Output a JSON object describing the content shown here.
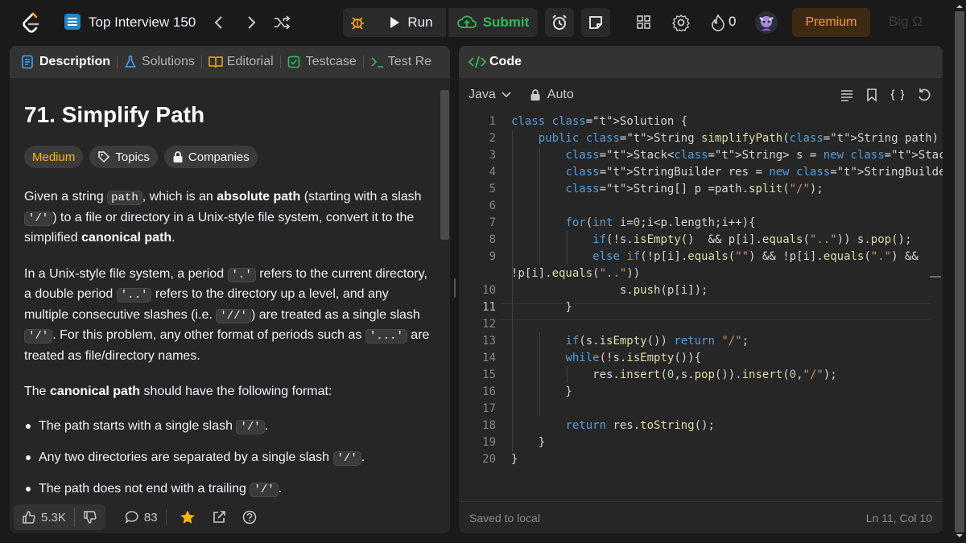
{
  "header": {
    "title": "Top Interview 150",
    "run_label": "Run",
    "submit_label": "Submit",
    "streak_count": "0",
    "premium_label": "Premium",
    "bigo_label": "Big Ω",
    "icons": [
      "leetcode-logo-icon",
      "list-icon",
      "chevron-left-icon",
      "chevron-right-icon",
      "shuffle-icon",
      "debug-icon",
      "run-play-icon",
      "upload-cloud-icon",
      "alarm-icon",
      "note-icon",
      "layout-icon",
      "gear-icon",
      "flame-icon",
      "avatar-icon"
    ]
  },
  "left_panel": {
    "tabs": [
      {
        "label": "Description",
        "icon": "document-icon",
        "active": true
      },
      {
        "label": "Solutions",
        "icon": "flask-icon"
      },
      {
        "label": "Editorial",
        "icon": "book-icon"
      },
      {
        "label": "Testcase",
        "icon": "check-box-icon"
      },
      {
        "label": "Test Re",
        "icon": "terminal-icon"
      }
    ],
    "problem_title": "71. Simplify Path",
    "difficulty": "Medium",
    "topics_label": "Topics",
    "companies_label": "Companies",
    "paragraphs": {
      "p1": {
        "a": "Given a string ",
        "code1": "path",
        "b": ", which is an ",
        "bold1": "absolute path",
        "c": " (starting with a slash ",
        "code2": "'/'",
        "d": ") to a file or directory in a Unix-style file system, convert it to the simplified ",
        "bold2": "canonical path",
        "e": "."
      },
      "p2": {
        "a": "In a Unix-style file system, a period ",
        "code1": "'.'",
        "b": " refers to the current directory, a double period ",
        "code2": "'..'",
        "c": " refers to the directory up a level, and any multiple consecutive slashes (i.e. ",
        "code3": "'//'",
        "d": ") are treated as a single slash ",
        "code4": "'/'",
        "e": ". For this problem, any other format of periods such as ",
        "code5": "'...'",
        "f": " are treated as file/directory names."
      },
      "p3": {
        "a": "The ",
        "bold": "canonical path",
        "b": " should have the following format:"
      }
    },
    "bullets": [
      {
        "text": "The path starts with a single slash ",
        "code": "'/'",
        "end": "."
      },
      {
        "text": "Any two directories are separated by a single slash ",
        "code": "'/'",
        "end": "."
      },
      {
        "text": "The path does not end with a trailing ",
        "code": "'/'",
        "end": "."
      }
    ],
    "footer": {
      "likes": "5.3K",
      "comments": "83"
    }
  },
  "right_panel": {
    "tab_label": "Code",
    "language": "Java",
    "mode": "Auto",
    "status": "Saved to local",
    "cursor": "Ln 11, Col 10",
    "current_line": 11,
    "code_lines": [
      "class Solution {",
      "    public String simplifyPath(String path) {",
      "        Stack<String> s = new Stack<>();",
      "        StringBuilder res = new StringBuilder();",
      "        String[] p =path.split(\"/\");",
      "",
      "        for(int i=0;i<p.length;i++){",
      "            if(!s.isEmpty()  && p[i].equals(\"..\")) s.pop();",
      "            else if(!p[i].equals(\"\") && !p[i].equals(\".\") &&",
      "!p[i].equals(\"..\"))",
      "                s.push(p[i]);",
      "        }",
      "",
      "        if(s.isEmpty()) return \"/\";",
      "        while(!s.isEmpty()){",
      "            res.insert(0,s.pop()).insert(0,\"/\");",
      "        }",
      "",
      "        return res.toString();",
      "    }",
      "}"
    ],
    "line_numbers": [
      "1",
      "2",
      "3",
      "4",
      "5",
      "6",
      "7",
      "8",
      "9",
      "",
      "10",
      "11",
      "12",
      "13",
      "14",
      "15",
      "16",
      "17",
      "18",
      "19",
      "20"
    ]
  },
  "colors": {
    "accent": "#ffa116",
    "success": "#2cbb5d",
    "medium": "#ffb800",
    "keyword": "#569cd6",
    "type": "#4ec9b0",
    "string": "#ce9178"
  }
}
